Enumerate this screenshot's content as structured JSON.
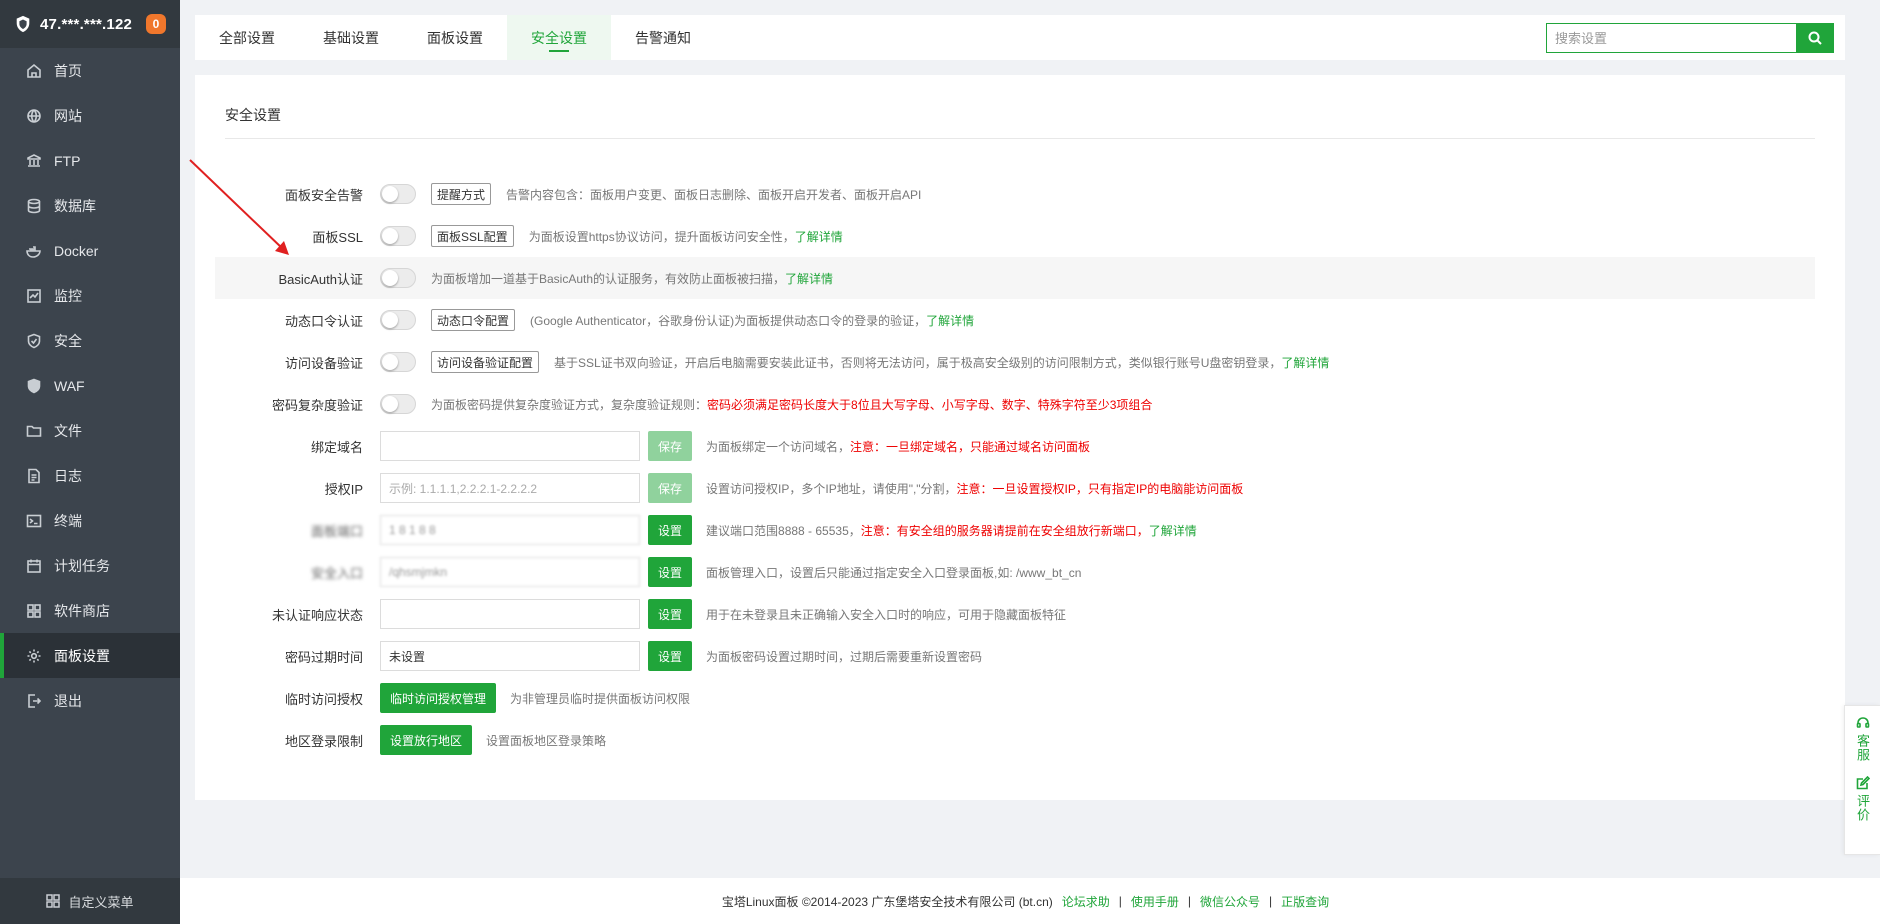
{
  "sidebar": {
    "server_ip": "47.***.***.122",
    "notification_count": "0",
    "items": [
      {
        "label": "首页",
        "icon": "home-icon"
      },
      {
        "label": "网站",
        "icon": "globe-icon"
      },
      {
        "label": "FTP",
        "icon": "ftp-icon"
      },
      {
        "label": "数据库",
        "icon": "database-icon"
      },
      {
        "label": "Docker",
        "icon": "docker-icon"
      },
      {
        "label": "监控",
        "icon": "monitor-icon"
      },
      {
        "label": "安全",
        "icon": "shield-icon"
      },
      {
        "label": "WAF",
        "icon": "waf-icon"
      },
      {
        "label": "文件",
        "icon": "folder-icon"
      },
      {
        "label": "日志",
        "icon": "log-icon"
      },
      {
        "label": "终端",
        "icon": "terminal-icon"
      },
      {
        "label": "计划任务",
        "icon": "calendar-icon"
      },
      {
        "label": "软件商店",
        "icon": "store-icon"
      },
      {
        "label": "面板设置",
        "icon": "gear-icon"
      },
      {
        "label": "退出",
        "icon": "logout-icon"
      }
    ],
    "active_item": "面板设置",
    "footer_label": "自定义菜单"
  },
  "tabs": [
    "全部设置",
    "基础设置",
    "面板设置",
    "安全设置",
    "告警通知"
  ],
  "active_tab": "安全设置",
  "search": {
    "placeholder": "搜索设置"
  },
  "section_title": "安全设置",
  "rows": {
    "alarm": {
      "label": "面板安全告警",
      "button": "提醒方式",
      "desc": "告警内容包含：面板用户变更、面板日志删除、面板开启开发者、面板开启API"
    },
    "ssl": {
      "label": "面板SSL",
      "button": "面板SSL配置",
      "desc": "为面板设置https协议访问，提升面板访问安全性，",
      "link": "了解详情"
    },
    "basicauth": {
      "label": "BasicAuth认证",
      "desc": "为面板增加一道基于BasicAuth的认证服务，有效防止面板被扫描，",
      "link": "了解详情"
    },
    "totp": {
      "label": "动态口令认证",
      "button": "动态口令配置",
      "desc": "(Google Authenticator，谷歌身份认证)为面板提供动态口令的登录的验证，",
      "link": "了解详情"
    },
    "device": {
      "label": "访问设备验证",
      "button": "访问设备验证配置",
      "desc": "基于SSL证书双向验证，开启后电脑需要安装此证书，否则将无法访问，属于极高安全级别的访问限制方式，类似银行账号U盘密钥登录，",
      "link": "了解详情"
    },
    "complexity": {
      "label": "密码复杂度验证",
      "desc": "为面板密码提供复杂度验证方式，复杂度验证规则：",
      "warn": "密码必须满足密码长度大于8位且大写字母、小写字母、数字、特殊字符至少3项组合"
    },
    "domain": {
      "label": "绑定域名",
      "value": "",
      "button": "保存",
      "desc": "为面板绑定一个访问域名，",
      "warn": "注意：一旦绑定域名，只能通过域名访问面板"
    },
    "ip": {
      "label": "授权IP",
      "placeholder": "示例: 1.1.1.1,2.2.2.1-2.2.2.2",
      "button": "保存",
      "desc": "设置访问授权IP，多个IP地址，请使用\",\"分割，",
      "warn": "注意：一旦设置授权IP，只有指定IP的电脑能访问面板"
    },
    "port": {
      "label": "面板端口",
      "value": "1 8 1 8 8",
      "button": "设置",
      "desc": "建议端口范围8888 - 65535，",
      "warn": "注意：有安全组的服务器请提前在安全组放行新端口，",
      "link": "了解详情"
    },
    "entry": {
      "label": "安全入口",
      "value": "/qhsmjmkn",
      "button": "设置",
      "desc": "面板管理入口，设置后只能通过指定安全入口登录面板,如: /www_bt_cn"
    },
    "unauth": {
      "label": "未认证响应状态",
      "value": "",
      "button": "设置",
      "desc": "用于在未登录且未正确输入安全入口时的响应，可用于隐藏面板特征"
    },
    "expire": {
      "label": "密码过期时间",
      "value": "未设置",
      "button": "设置",
      "desc": "为面板密码设置过期时间，过期后需要重新设置密码"
    },
    "temp": {
      "label": "临时访问授权",
      "button": "临时访问授权管理",
      "desc": "为非管理员临时提供面板访问权限"
    },
    "region": {
      "label": "地区登录限制",
      "button": "设置放行地区",
      "desc": "设置面板地区登录策略"
    }
  },
  "footer": {
    "copyright": "宝塔Linux面板 ©2014-2023 广东堡塔安全技术有限公司 (bt.cn)",
    "links": [
      "论坛求助",
      "使用手册",
      "微信公众号",
      "正版查询"
    ]
  },
  "float": {
    "service": "客服",
    "review": "评价"
  },
  "colors": {
    "accent": "#20a53a",
    "sidebar": "#3c444d",
    "warning": "#ee0000"
  }
}
